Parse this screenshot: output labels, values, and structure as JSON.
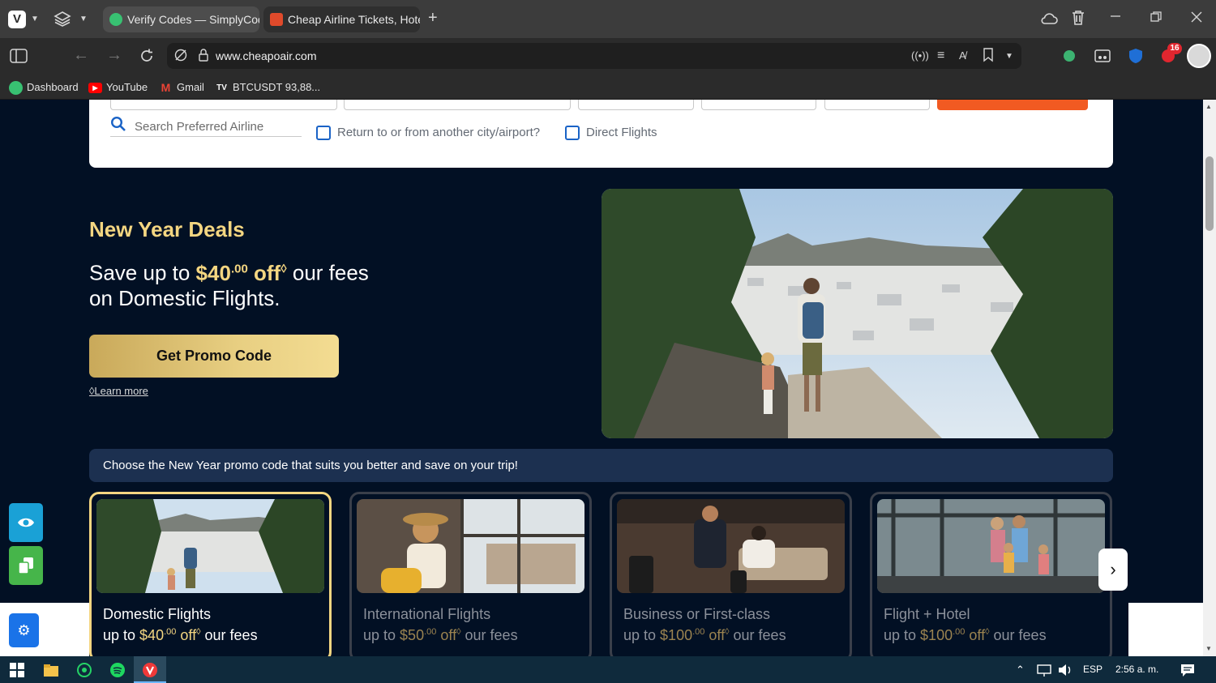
{
  "browser": {
    "tabs": [
      {
        "label": "Verify Codes — SimplyCodes",
        "active": true
      },
      {
        "label": "Cheap Airline Tickets, Hotels",
        "active": false
      }
    ],
    "new_tab": "+",
    "url": "www.cheapoair.com",
    "extension_badge": "16",
    "bookmarks": [
      {
        "label": "Dashboard",
        "icon": "simplycodes-icon"
      },
      {
        "label": "YouTube",
        "icon": "youtube-icon"
      },
      {
        "label": "Gmail",
        "icon": "gmail-icon"
      },
      {
        "label": "BTCUSDT 93,88...",
        "icon": "tradingview-icon"
      }
    ]
  },
  "search": {
    "airline_placeholder": "Search Preferred Airline",
    "return_other_city": "Return to or from another city/airport?",
    "direct_flights": "Direct Flights"
  },
  "hero": {
    "title": "New Year Deals",
    "line1_prefix": "Save up to ",
    "amount": "$40",
    "cents": ".00",
    "off": " off",
    "diamond": "◊",
    "line1_suffix": " our fees",
    "line2": "on Domestic Flights.",
    "button": "Get Promo Code",
    "learn_more": "◊Learn more"
  },
  "banner": "Choose the New Year promo code that suits you better and save on your trip!",
  "cards": [
    {
      "title": "Domestic Flights",
      "prefix": "up to ",
      "amount": "$40",
      "cents": ".00",
      "off": " off",
      "diamond": "◊",
      "suffix": " our fees",
      "active": true
    },
    {
      "title": "International Flights",
      "prefix": "up to ",
      "amount": "$50",
      "cents": ".00",
      "off": " off",
      "diamond": "◊",
      "suffix": " our fees",
      "active": false
    },
    {
      "title": "Business or First-class",
      "prefix": "up to ",
      "amount": "$100",
      "cents": ".00",
      "off": " off",
      "diamond": "◊",
      "suffix": " our fees",
      "active": false
    },
    {
      "title": "Flight + Hotel",
      "prefix": "up to ",
      "amount": "$100",
      "cents": ".00",
      "off": " off",
      "diamond": "◊",
      "suffix": " our fees",
      "active": false
    }
  ],
  "next_arrow": "›",
  "taskbar": {
    "lang": "ESP",
    "time": "2:56 a. m."
  },
  "colors": {
    "page_bg": "#021024",
    "gold": "#f4d681",
    "orange": "#f15a22",
    "banner_bg": "#1c3050",
    "checkbox_blue": "#1a63c6"
  }
}
